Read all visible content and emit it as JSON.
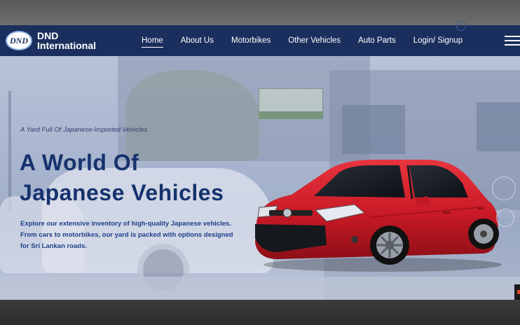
{
  "brand": {
    "logo_mark": "DND",
    "name_line1": "DND",
    "name_line2": "International"
  },
  "nav": {
    "items": [
      {
        "label": "Home",
        "active": true
      },
      {
        "label": "About Us",
        "active": false
      },
      {
        "label": "Motorbikes",
        "active": false
      },
      {
        "label": "Other Vehicles",
        "active": false
      },
      {
        "label": "Auto Parts",
        "active": false
      },
      {
        "label": "Login/ Signup",
        "active": false
      }
    ],
    "menu_icon": "hamburger-menu-icon"
  },
  "hero": {
    "tagline": "A Yard Full Of Japanese-Imported Vehicles",
    "headline_line1": "A World Of",
    "headline_line2": "Japanese Vehicles",
    "description_line1": "Explore our extensive inventory of high-quality Japanese vehicles.",
    "description_line2": "From cars to motorbikes, our yard is packed with options designed",
    "description_line3": "for Sri Lankan roads."
  },
  "colors": {
    "navbar_bg": "#1b2f5e",
    "headline": "#16326e",
    "description": "#1f3f8a",
    "car_body": "#d41f2b"
  }
}
